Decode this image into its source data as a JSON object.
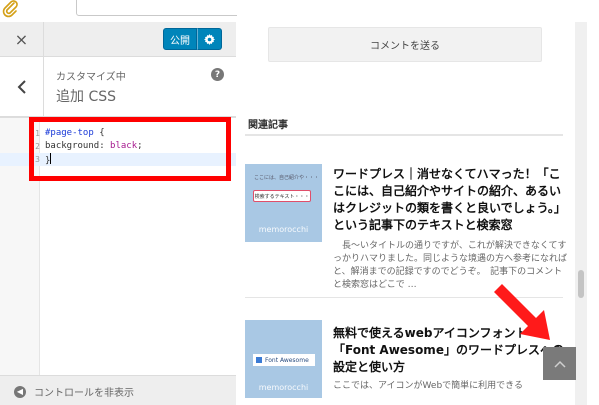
{
  "customizer": {
    "close_glyph": "×",
    "publish_label": "公開",
    "customizing_label": "カスタマイズ中",
    "section_title": "追加 CSS",
    "help_glyph": "?",
    "hide_controls_label": "コントロールを非表示"
  },
  "editor": {
    "line_numbers": [
      "1",
      "2",
      "3"
    ],
    "line1_selector": "#page-top",
    "line1_brace": " {",
    "line2_property": "background",
    "line2_colon": ": ",
    "line2_value": "black",
    "line2_semi": ";",
    "line3_brace": "}"
  },
  "preview": {
    "comment_button_label": "コメントを送る",
    "related_heading": "関連記事",
    "posts": [
      {
        "title": "ワードプレス｜消せなくてハマった！「ここには、自己紹介やサイトの紹介、あるいはクレジットの類を書くと良いでしょう。」という記事下のテキストと検索窓",
        "excerpt": "　長～いタイトルの通りですが、これが解決できなくてすっかりハマりました。同じような境遇の方へ参考になればと、解消までの記録ですのでどうぞ。　記事下のコメントと検索窓はどこで …",
        "thumb_small_text": "ここには、自己紹介や・・・",
        "thumb_pill_text": "検索するテキスト・・・",
        "thumb_mark": "memorocchi"
      },
      {
        "title": "無料で使えるwebアイコンフォント「Font Awesome」のワードプレスへの設定と使い方",
        "excerpt": "ここでは、アイコンがWebで簡単に利用できる",
        "thumb_tag": "Font Awesome",
        "thumb_mark": "memorocchi"
      }
    ]
  },
  "colors": {
    "publish_blue": "#0085ba",
    "highlight_red": "#ff0000"
  },
  "icons": {
    "attachment": "paperclip-icon",
    "gear": "gear-icon",
    "back": "chevron-left-icon",
    "page_top": "chevron-up-icon"
  }
}
